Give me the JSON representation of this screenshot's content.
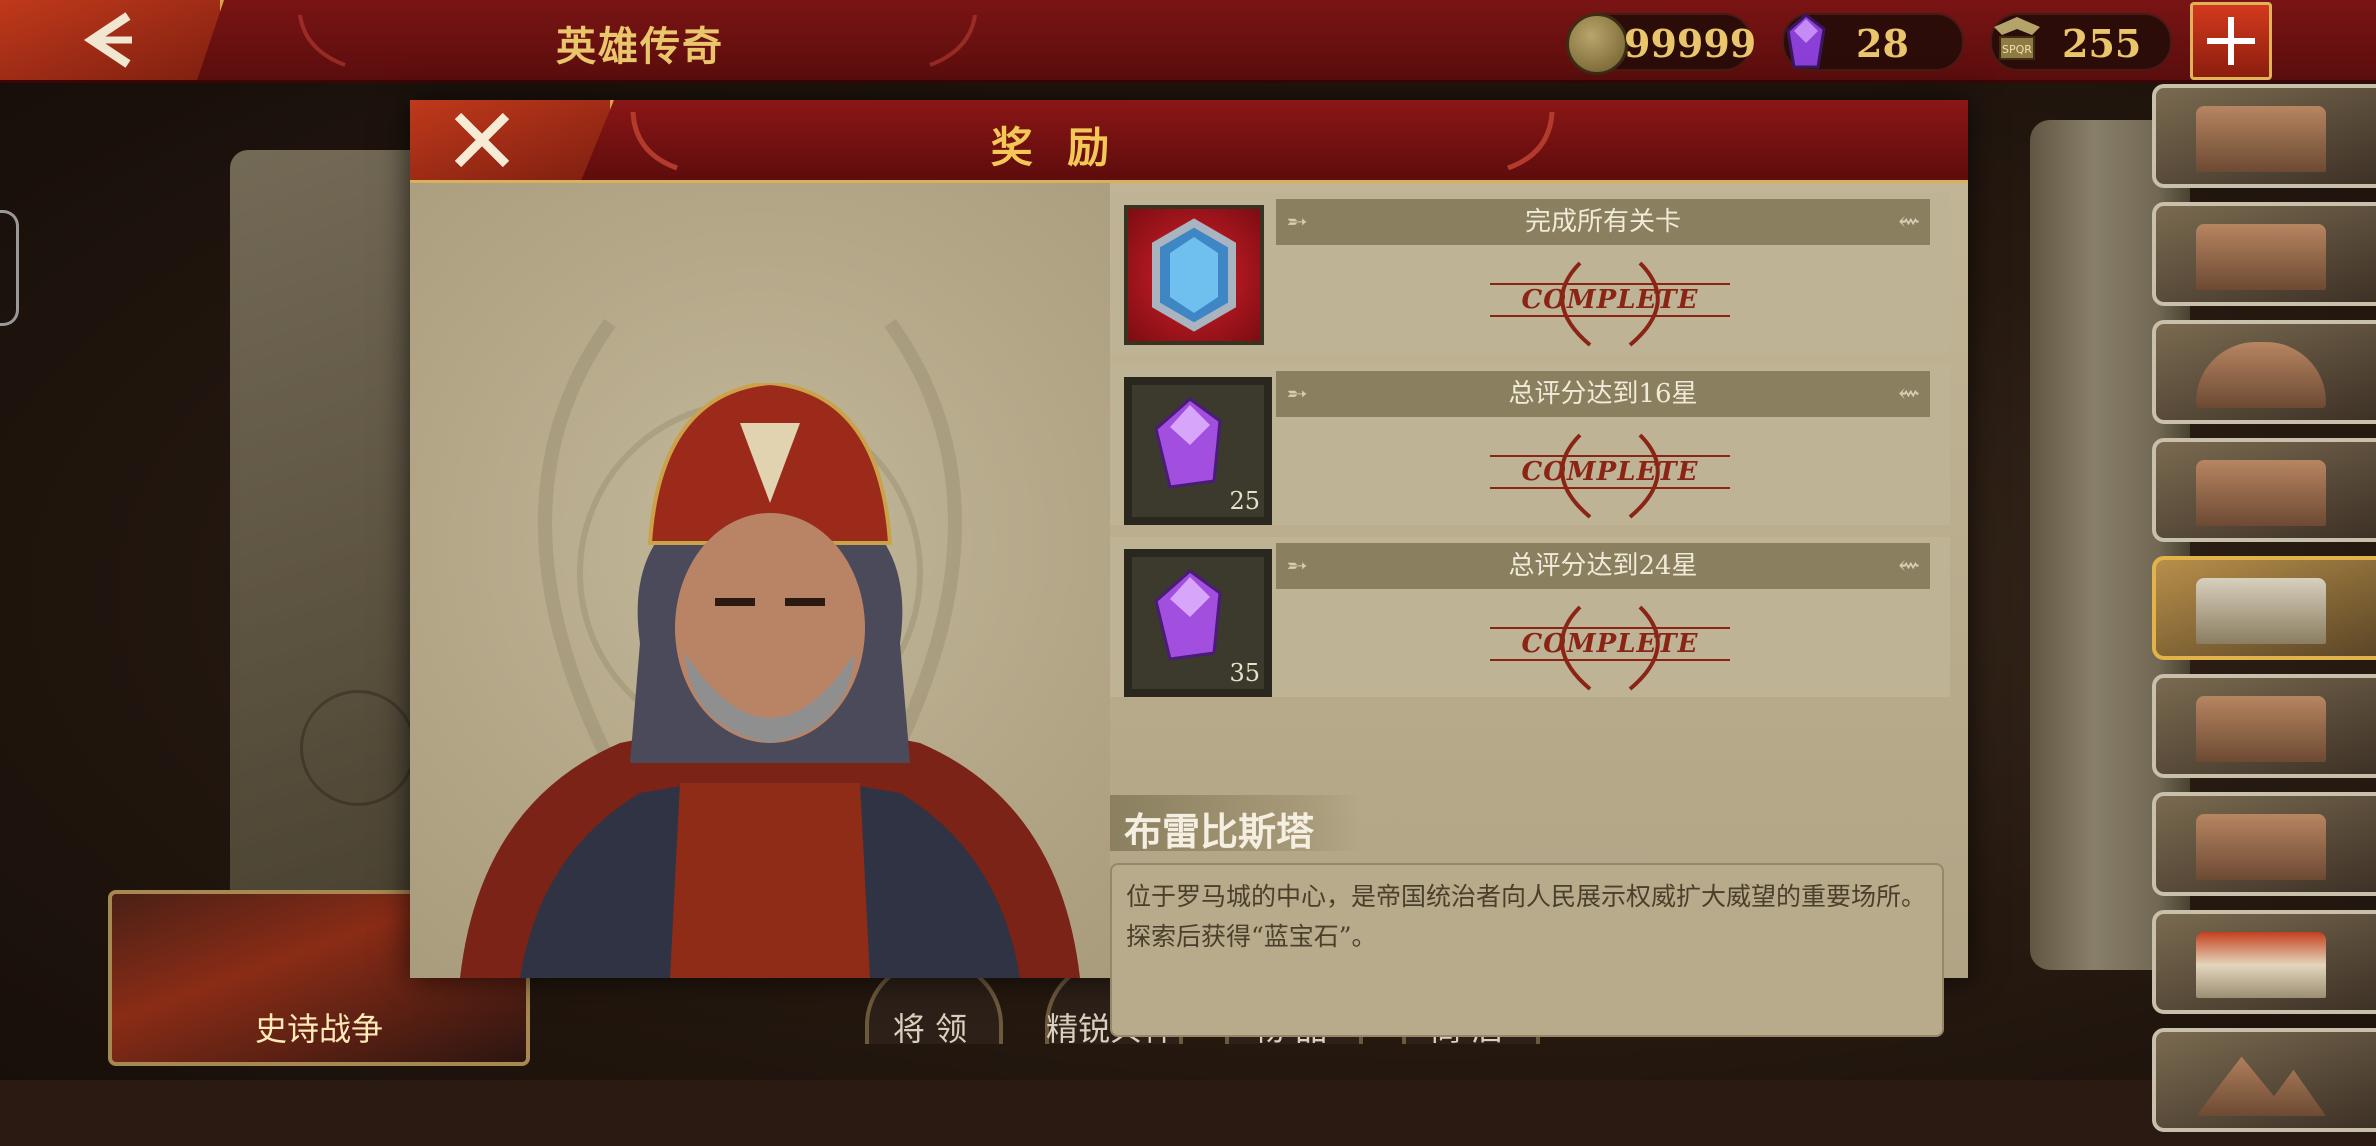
{
  "topbar": {
    "title": "英雄传奇",
    "coins": "99999",
    "gems": "28",
    "spqr": "255",
    "spqr_icon_text": "SPQR"
  },
  "modal": {
    "title": "奖 励",
    "rewards": [
      {
        "condition": "完成所有关卡",
        "status": "COMPLETE",
        "item": "sapphire",
        "count": ""
      },
      {
        "condition": "总评分达到16星",
        "status": "COMPLETE",
        "item": "amethyst",
        "count": "25"
      },
      {
        "condition": "总评分达到24星",
        "status": "COMPLETE",
        "item": "amethyst",
        "count": "35"
      }
    ],
    "place_name": "布雷比斯塔",
    "description_line1": "位于罗马城的中心，是帝国统治者向人民展示权威扩大威望的重要场所。",
    "description_line2": "探索后获得“蓝宝石”。"
  },
  "bottom": {
    "epic_war": "史诗战争",
    "nav": [
      "将 领",
      "精锐兵种",
      "物 品",
      "商 店"
    ]
  },
  "colors": {
    "accent_red": "#7a1414",
    "gold_text": "#e9c56b",
    "complete_red": "#8a2415"
  }
}
